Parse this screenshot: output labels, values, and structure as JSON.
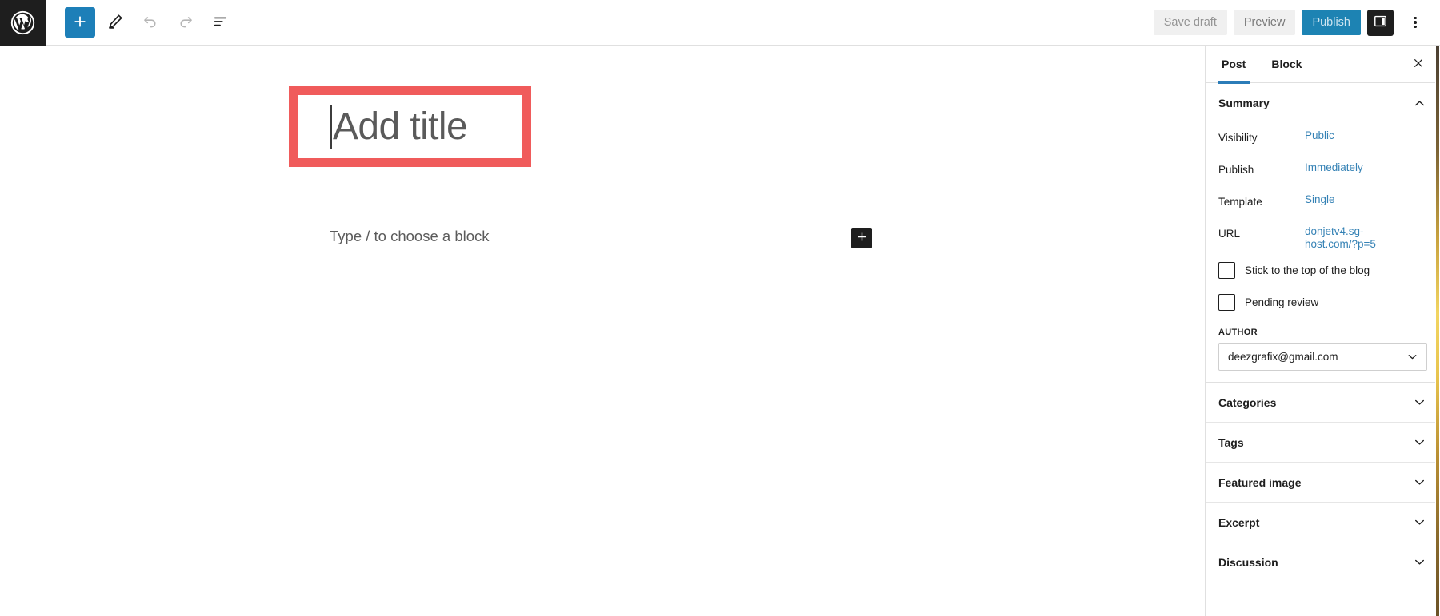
{
  "topbar": {
    "logo_icon": "wordpress-logo-icon",
    "tools": [
      {
        "name": "add-block-button",
        "icon": "plus-icon",
        "label": "",
        "state": "primary"
      },
      {
        "name": "edit-tool-button",
        "icon": "pencil-icon",
        "label": "",
        "state": "default"
      },
      {
        "name": "undo-button",
        "icon": "undo-arrow-icon",
        "label": "",
        "state": "disabled"
      },
      {
        "name": "redo-button",
        "icon": "redo-arrow-icon",
        "label": "",
        "state": "disabled"
      },
      {
        "name": "document-overview-button",
        "icon": "list-view-icon",
        "label": "",
        "state": "default"
      }
    ],
    "save_draft_label": "Save draft",
    "preview_label": "Preview",
    "publish_label": "Publish",
    "settings_toggle_icon": "sidebar-panel-icon",
    "options_icon": "kebab-menu-icon"
  },
  "editor": {
    "title_placeholder": "Add title",
    "block_prompt": "Type / to choose a block",
    "inline_adder_icon": "plus-icon",
    "highlight_color": "#f05b5b"
  },
  "sidebar": {
    "tabs": [
      {
        "label": "Post",
        "active": true
      },
      {
        "label": "Block",
        "active": false
      }
    ],
    "close_icon": "close-x-icon",
    "summary": {
      "title": "Summary",
      "chevron": "chevron-up-icon",
      "rows": [
        {
          "label": "Visibility",
          "value": "Public"
        },
        {
          "label": "Publish",
          "value": "Immediately"
        },
        {
          "label": "Template",
          "value": "Single"
        },
        {
          "label": "URL",
          "value": "donjetv4.sg-host.com/?p=5"
        }
      ],
      "checkboxes": [
        {
          "label": "Stick to the top of the blog",
          "checked": false
        },
        {
          "label": "Pending review",
          "checked": false
        }
      ],
      "author_label": "AUTHOR",
      "author_value": "deezgrafix@gmail.com",
      "author_arrow_icon": "chevron-down-icon"
    },
    "panels": [
      {
        "label": "Categories",
        "chevron": "chevron-down-icon"
      },
      {
        "label": "Tags",
        "chevron": "chevron-down-icon"
      },
      {
        "label": "Featured image",
        "chevron": "chevron-down-icon"
      },
      {
        "label": "Excerpt",
        "chevron": "chevron-down-icon"
      },
      {
        "label": "Discussion",
        "chevron": "chevron-down-icon"
      }
    ]
  },
  "colors": {
    "accent_blue": "#1d7fb8",
    "link_blue": "#3582b5",
    "dark": "#1e1e1e",
    "highlight_red": "#f05b5b"
  }
}
